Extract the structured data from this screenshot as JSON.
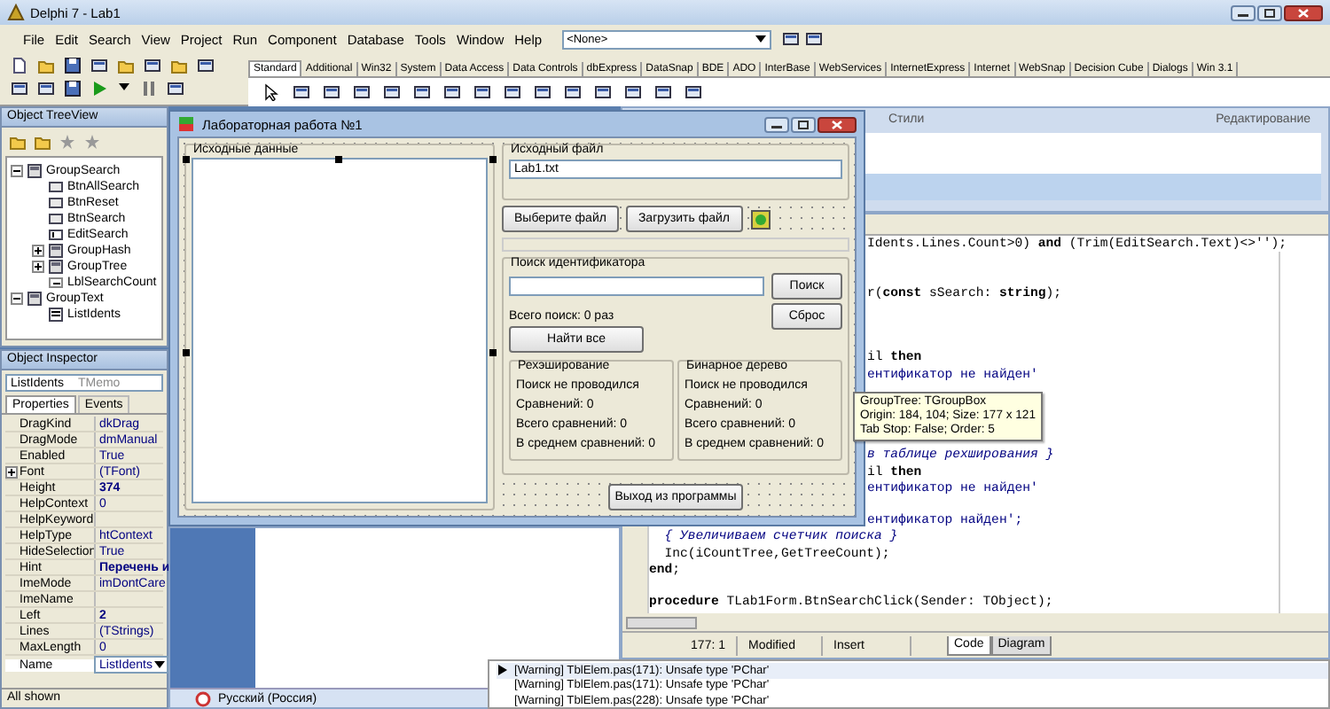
{
  "ide": {
    "title": "Delphi 7 - Lab1",
    "menu": [
      "File",
      "Edit",
      "Search",
      "View",
      "Project",
      "Run",
      "Component",
      "Database",
      "Tools",
      "Window",
      "Help"
    ],
    "form_combo": "<None>",
    "palette_tabs": [
      {
        "label": "Standard",
        "selected": true
      },
      {
        "label": "Additional",
        "selected": false
      },
      {
        "label": "Win32",
        "selected": false
      },
      {
        "label": "System",
        "selected": false
      },
      {
        "label": "Data Access",
        "selected": false
      },
      {
        "label": "Data Controls",
        "selected": false
      },
      {
        "label": "dbExpress",
        "selected": false
      },
      {
        "label": "DataSnap",
        "selected": false
      },
      {
        "label": "BDE",
        "selected": false
      },
      {
        "label": "ADO",
        "selected": false
      },
      {
        "label": "InterBase",
        "selected": false
      },
      {
        "label": "WebServices",
        "selected": false
      },
      {
        "label": "InternetExpress",
        "selected": false
      },
      {
        "label": "Internet",
        "selected": false
      },
      {
        "label": "WebSnap",
        "selected": false
      },
      {
        "label": "Decision Cube",
        "selected": false
      },
      {
        "label": "Dialogs",
        "selected": false
      },
      {
        "label": "Win 3.1",
        "selected": false
      }
    ]
  },
  "object_treeview": {
    "title": "Object TreeView",
    "tree": [
      {
        "label": "GroupSearch",
        "kind": "group",
        "expanded": true,
        "children": [
          {
            "label": "BtnAllSearch",
            "kind": "button"
          },
          {
            "label": "BtnReset",
            "kind": "button"
          },
          {
            "label": "BtnSearch",
            "kind": "button"
          },
          {
            "label": "EditSearch",
            "kind": "edit"
          },
          {
            "label": "GroupHash",
            "kind": "group",
            "expanded": false
          },
          {
            "label": "GroupTree",
            "kind": "group",
            "expanded": false
          },
          {
            "label": "LblSearchCount",
            "kind": "label"
          }
        ]
      },
      {
        "label": "GroupText",
        "kind": "group",
        "expanded": true,
        "children": [
          {
            "label": "ListIdents",
            "kind": "memo"
          }
        ]
      }
    ]
  },
  "object_inspector": {
    "title": "Object Inspector",
    "object": "ListIdents",
    "object_type": "TMemo",
    "tabs": [
      {
        "label": "Properties",
        "selected": true
      },
      {
        "label": "Events",
        "selected": false
      }
    ],
    "properties": [
      {
        "name": "DragKind",
        "value": "dkDrag",
        "kind": "plain",
        "bold": false,
        "selected": false
      },
      {
        "name": "DragMode",
        "value": "dmManual",
        "kind": "plain",
        "bold": false,
        "selected": false
      },
      {
        "name": "Enabled",
        "value": "True",
        "kind": "plain",
        "bold": false,
        "selected": false
      },
      {
        "name": "Font",
        "value": "(TFont)",
        "kind": "expandable",
        "bold": false,
        "selected": false
      },
      {
        "name": "Height",
        "value": "374",
        "kind": "plain",
        "bold": true,
        "selected": false
      },
      {
        "name": "HelpContext",
        "value": "0",
        "kind": "plain",
        "bold": false,
        "selected": false
      },
      {
        "name": "HelpKeyword",
        "kind": "plain",
        "selected": false
      },
      {
        "name": "HelpType",
        "value": "htContext",
        "kind": "plain",
        "bold": false,
        "selected": false
      },
      {
        "name": "HideSelection",
        "value": "True",
        "kind": "plain",
        "bold": false,
        "selected": false
      },
      {
        "name": "Hint",
        "value": "Перечень и",
        "kind": "plain",
        "bold": true,
        "selected": false
      },
      {
        "name": "ImeMode",
        "value": "imDontCare",
        "kind": "plain",
        "bold": false,
        "selected": false
      },
      {
        "name": "ImeName",
        "kind": "plain",
        "selected": false
      },
      {
        "name": "Left",
        "value": "2",
        "kind": "plain",
        "bold": true,
        "selected": false
      },
      {
        "name": "Lines",
        "value": "(TStrings)",
        "kind": "plain",
        "bold": false,
        "selected": false
      },
      {
        "name": "MaxLength",
        "value": "0",
        "kind": "plain",
        "bold": false,
        "selected": false
      },
      {
        "name": "Name",
        "value": "ListIdents",
        "kind": "plain",
        "bold": false,
        "selected": true
      }
    ],
    "footer": "All shown"
  },
  "ribbon": {
    "labels": [
      "Стили",
      "Редактирование"
    ]
  },
  "code_editor": {
    "lines": [
      {
        "kind": "code",
        "clipped": true,
        "text": "Idents.Lines.Count>0) **and** (Trim(EditSearch.Text)<>'');"
      },
      {
        "kind": "blank"
      },
      {
        "kind": "blank"
      },
      {
        "kind": "code",
        "clipped": true,
        "text": "r(**const** sSearch: **string**);"
      },
      {
        "kind": "blank"
      },
      {
        "kind": "blank"
      },
      {
        "kind": "blank"
      },
      {
        "kind": "code",
        "clipped": true,
        "text": "il **then**"
      },
      {
        "kind": "string",
        "clipped": true,
        "text": "ентификатор не найден'"
      },
      {
        "kind": "blank"
      },
      {
        "kind": "blank"
      },
      {
        "kind": "blank"
      },
      {
        "kind": "blank"
      },
      {
        "kind": "comment",
        "clipped": true,
        "text": "в таблице рехширования }"
      },
      {
        "kind": "code",
        "clipped": true,
        "text": "il **then**"
      },
      {
        "kind": "string",
        "clipped": true,
        "text": "ентификатор не найден'"
      },
      {
        "kind": "blank"
      },
      {
        "kind": "string",
        "clipped": true,
        "text": "ентификатор найден';"
      },
      {
        "kind": "comment",
        "clipped": false,
        "text": "  { Увеличиваем счетчик поиска }"
      },
      {
        "kind": "code",
        "clipped": false,
        "text": "  Inc(iCountTree,GetTreeCount);"
      },
      {
        "kind": "code",
        "clipped": false,
        "text": "**end**;"
      },
      {
        "kind": "blank"
      },
      {
        "kind": "code",
        "clipped": false,
        "text": "**procedure** TLab1Form.BtnSearchClick(Sender: TObject);"
      }
    ],
    "status": {
      "position": "177:  1",
      "state": "Modified",
      "mode": "Insert"
    },
    "tabs": [
      {
        "label": "Code",
        "selected": true
      },
      {
        "label": "Diagram",
        "selected": false
      }
    ]
  },
  "messages": [
    {
      "text": "[Warning] TblElem.pas(171): Unsafe type 'PChar'",
      "selected": true
    },
    {
      "text": "[Warning] TblElem.pas(171): Unsafe type 'PChar'",
      "selected": false
    },
    {
      "text": "[Warning] TblElem.pas(228): Unsafe type 'PChar'",
      "selected": false
    }
  ],
  "language_bar": {
    "label": "Русский (Россия)"
  },
  "form": {
    "title": "Лабораторная работа №1",
    "source_group": {
      "title": "Исходные данные"
    },
    "file_group": {
      "title": "Исходный файл",
      "file_field": "Lab1.txt",
      "buttons": [
        "Выберите файл",
        "Загрузить файл"
      ]
    },
    "search_group": {
      "title": "Поиск идентификатора",
      "search_button": "Поиск",
      "reset_button": "Сброс",
      "total_label": "Всего поиск: 0 раз",
      "find_all_button": "Найти все",
      "results": [
        {
          "title": "Рехэширование",
          "lines": [
            "Поиск не проводился",
            "Сравнений: 0",
            "Всего сравнений: 0",
            "В среднем сравнений: 0"
          ]
        },
        {
          "title": "Бинарное дерево",
          "lines": [
            "Поиск не проводился",
            "Сравнений: 0",
            "Всего сравнений: 0",
            "В среднем сравнений: 0"
          ]
        }
      ]
    },
    "exit_button": "Выход из программы"
  },
  "tooltip": {
    "lines": [
      "GroupTree: TGroupBox",
      "Origin: 184, 104; Size: 177 x 121",
      "Tab Stop: False; Order: 5"
    ]
  }
}
